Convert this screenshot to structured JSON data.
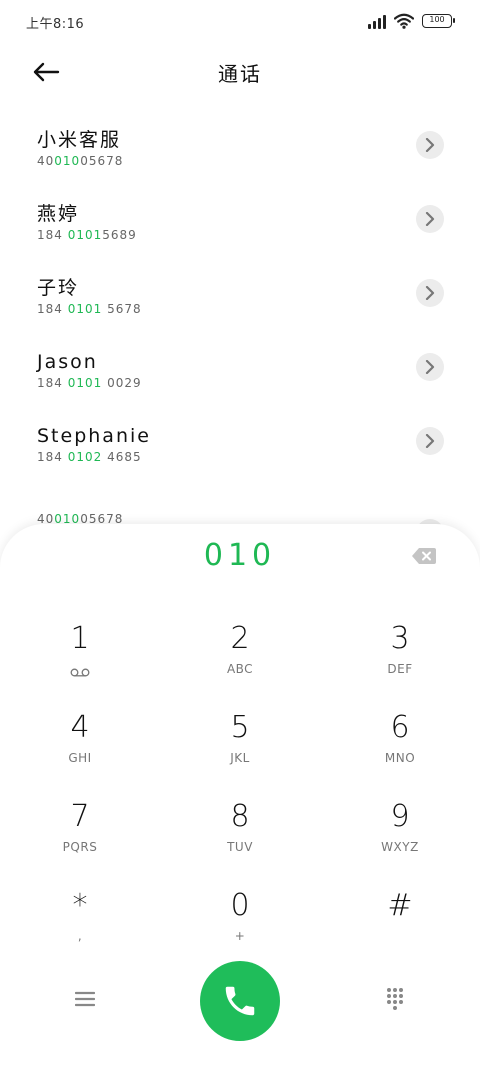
{
  "status_bar": {
    "time": "上午8:16",
    "battery": "100"
  },
  "header": {
    "title": "通话"
  },
  "contacts": [
    {
      "name": "小米客服",
      "number_pre": "40",
      "number_hl": "010",
      "number_post": "05678"
    },
    {
      "name": "燕婷",
      "number_pre": "184 ",
      "number_hl": "0101",
      "number_post": "5689"
    },
    {
      "name": "子玲",
      "number_pre": "184 ",
      "number_hl": "0101",
      "number_post": " 5678"
    },
    {
      "name": "Jason",
      "number_pre": "184 ",
      "number_hl": "0101",
      "number_post": " 0029"
    },
    {
      "name": "Stephanie",
      "number_pre": "184 ",
      "number_hl": "0102",
      "number_post": " 4685"
    }
  ],
  "partial_contact": {
    "number_pre": "40",
    "number_hl": "010",
    "number_post": "05678"
  },
  "dialpad": {
    "dialed": "010",
    "keys": [
      {
        "digit": "1",
        "letters": ""
      },
      {
        "digit": "2",
        "letters": "ABC"
      },
      {
        "digit": "3",
        "letters": "DEF"
      },
      {
        "digit": "4",
        "letters": "GHI"
      },
      {
        "digit": "5",
        "letters": "JKL"
      },
      {
        "digit": "6",
        "letters": "MNO"
      },
      {
        "digit": "7",
        "letters": "PQRS"
      },
      {
        "digit": "8",
        "letters": "TUV"
      },
      {
        "digit": "9",
        "letters": "WXYZ"
      },
      {
        "digit": "*",
        "letters": ","
      },
      {
        "digit": "0",
        "letters": "+"
      },
      {
        "digit": "#",
        "letters": ""
      }
    ]
  },
  "colors": {
    "accent": "#1fb854",
    "call_button": "#1fbd5a"
  },
  "icons": {
    "back": "arrow-left-icon",
    "chevron": "chevron-right-icon",
    "delete": "backspace-icon",
    "voicemail": "voicemail-icon",
    "menu": "hamburger-menu-icon",
    "call": "phone-icon",
    "keypad": "dialpad-icon"
  }
}
